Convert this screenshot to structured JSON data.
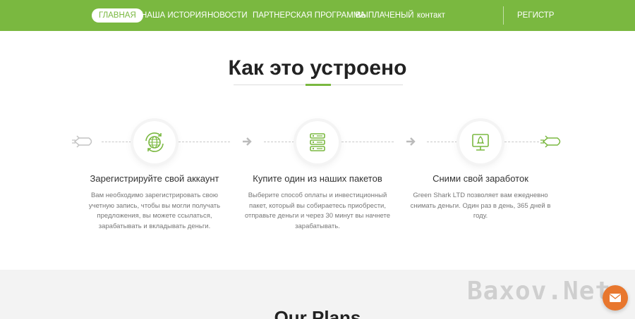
{
  "nav": {
    "items": [
      {
        "label": "ГЛАВНАЯ"
      },
      {
        "label": "НАША ИСТОРИЯ"
      },
      {
        "label": "НОВОСТИ"
      },
      {
        "label": "ПАРТНЕРСКАЯ ПРОГРАММА"
      },
      {
        "label": "ВЫПЛАЧЕНЫЙ"
      },
      {
        "label": "контакт"
      }
    ],
    "register_label": "РЕГИСТР"
  },
  "section": {
    "title": "Как это устроено"
  },
  "steps": [
    {
      "title": "Зарегистрируйте свой аккаунт",
      "text": "Вам необходимо зарегистрировать свою учетную запись, чтобы вы могли получать предложения, вы можете ссылаться, зарабатывать и вкладывать деньги.",
      "icon": "globe-refresh-icon"
    },
    {
      "title": "Купите один из наших пакетов",
      "text": "Выберите способ оплаты и инвестиционный пакет, который вы собираетесь приобрести, отправьте деньги и через 30 минут вы начнете зарабатывать.",
      "icon": "server-icon"
    },
    {
      "title": "Сними свой заработок",
      "text": "Green Shark LTD позволяет вам ежедневно снимать деньги. Один раз в день, 365 дней в году.",
      "icon": "rocket-launch-icon"
    }
  ],
  "plans": {
    "title": "Our Plans"
  },
  "watermark": "Baxov.Net",
  "colors": {
    "accent": "#7ab840",
    "chat_button": "#e8772e"
  }
}
